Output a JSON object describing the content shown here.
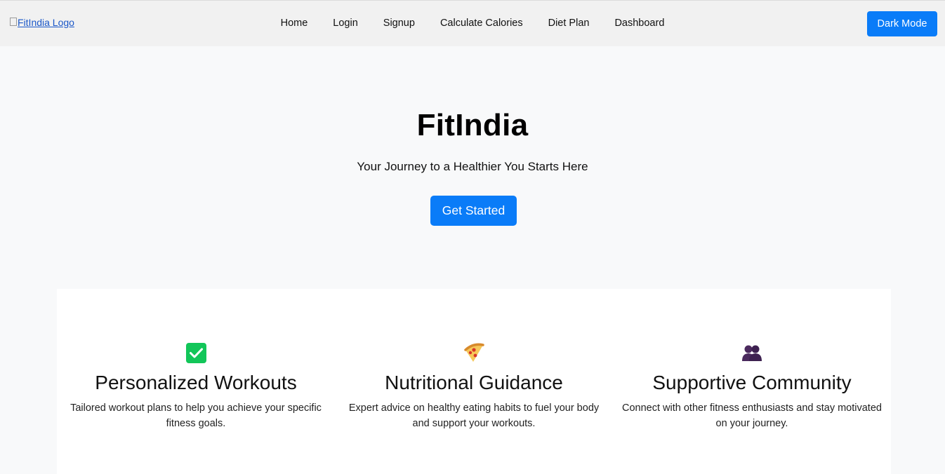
{
  "nav": {
    "logo_alt": "FitIndia Logo",
    "links": [
      "Home",
      "Login",
      "Signup",
      "Calculate Calories",
      "Diet Plan",
      "Dashboard"
    ],
    "dark_mode_label": "Dark Mode"
  },
  "hero": {
    "title": "FitIndia",
    "tagline": "Your Journey to a Healthier You Starts Here",
    "cta_label": "Get Started"
  },
  "features": [
    {
      "icon": "check-mark-icon",
      "title": "Personalized Workouts",
      "description": "Tailored workout plans to help you achieve your specific fitness goals."
    },
    {
      "icon": "pizza-icon",
      "title": "Nutritional Guidance",
      "description": "Expert advice on healthy eating habits to fuel your body and support your workouts."
    },
    {
      "icon": "people-icon",
      "title": "Supportive Community",
      "description": "Connect with other fitness enthusiasts and stay motivated on your journey."
    }
  ],
  "colors": {
    "accent": "#0a7cf8",
    "navbar_bg": "#f1f1f1",
    "page_bg": "#f8f9fa",
    "check_green": "#12c659"
  }
}
